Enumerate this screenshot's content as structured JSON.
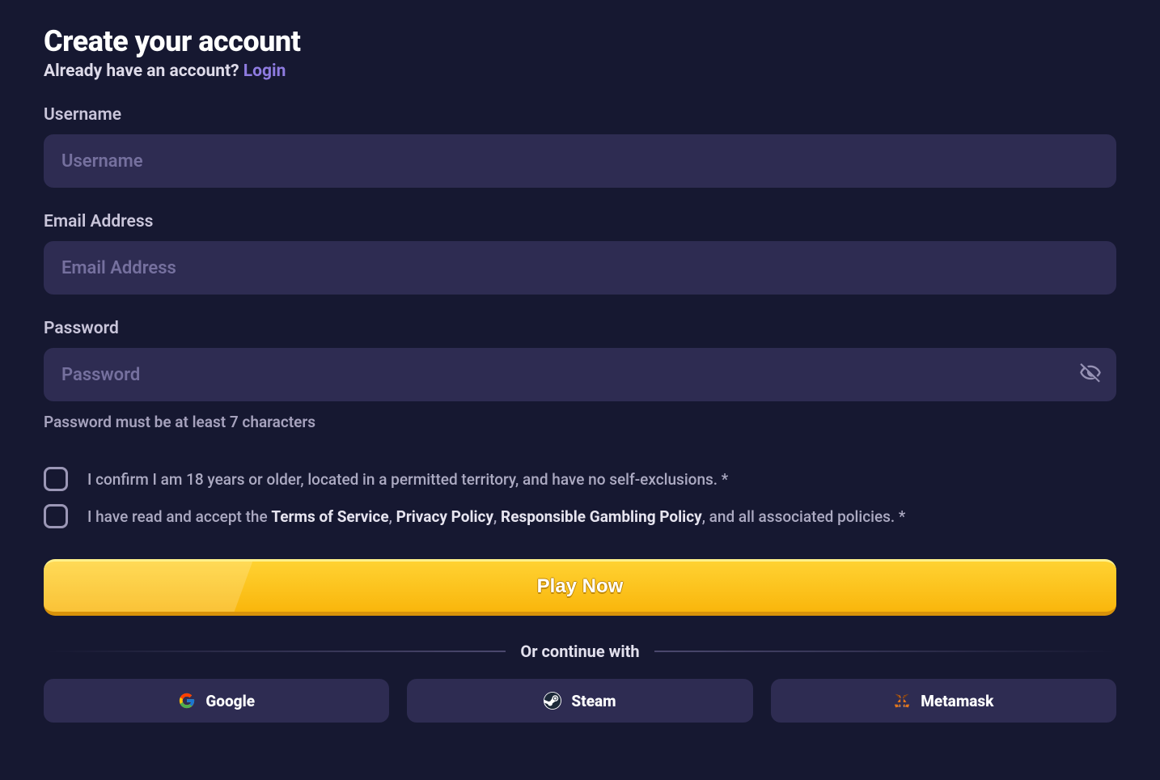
{
  "header": {
    "title": "Create your account",
    "prompt": "Already have an account?",
    "login": "Login"
  },
  "fields": {
    "username": {
      "label": "Username",
      "placeholder": "Username"
    },
    "email": {
      "label": "Email Address",
      "placeholder": "Email Address"
    },
    "password": {
      "label": "Password",
      "placeholder": "Password",
      "hint": "Password must be at least 7 characters"
    }
  },
  "checks": {
    "age": "I confirm I am 18 years or older, located in a permitted territory, and have no self-exclusions. *",
    "terms_pre": "I have read and accept the ",
    "tos": "Terms of Service",
    "sep1": ", ",
    "privacy": "Privacy Policy",
    "sep2": ", ",
    "rgp": "Responsible Gambling Policy",
    "terms_post": ", and all associated policies. *"
  },
  "cta": {
    "play": "Play Now"
  },
  "divider": "Or continue with",
  "social": {
    "google": "Google",
    "steam": "Steam",
    "metamask": "Metamask"
  }
}
